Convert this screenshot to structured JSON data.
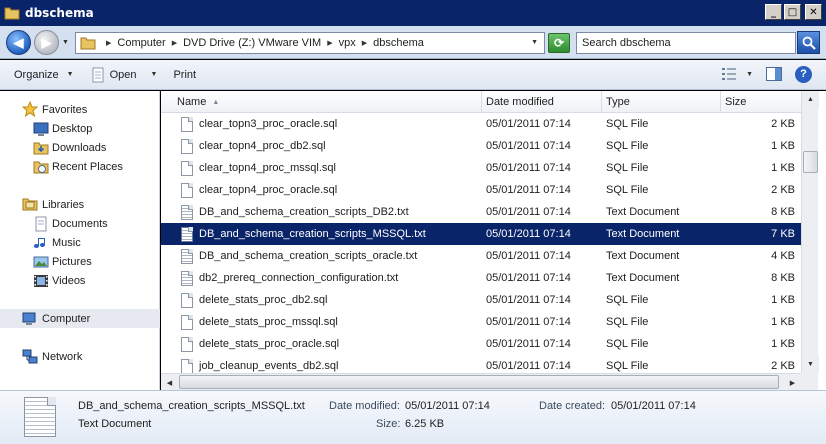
{
  "window": {
    "title": "dbschema"
  },
  "address": {
    "breadcrumbs": [
      "Computer",
      "DVD Drive (Z:) VMware VIM",
      "vpx",
      "dbschema"
    ],
    "search_placeholder": "Search dbschema"
  },
  "toolbar": {
    "organize": "Organize",
    "open": "Open",
    "print": "Print"
  },
  "nav": {
    "favorites": {
      "label": "Favorites",
      "items": [
        "Desktop",
        "Downloads",
        "Recent Places"
      ]
    },
    "libraries": {
      "label": "Libraries",
      "items": [
        "Documents",
        "Music",
        "Pictures",
        "Videos"
      ]
    },
    "computer": "Computer",
    "network": "Network"
  },
  "columns": {
    "name": "Name",
    "date": "Date modified",
    "type": "Type",
    "size": "Size"
  },
  "files": [
    {
      "name": "clear_topn3_proc_oracle.sql",
      "date": "05/01/2011 07:14",
      "type": "SQL File",
      "size": "2 KB",
      "kind": "sql"
    },
    {
      "name": "clear_topn4_proc_db2.sql",
      "date": "05/01/2011 07:14",
      "type": "SQL File",
      "size": "1 KB",
      "kind": "sql"
    },
    {
      "name": "clear_topn4_proc_mssql.sql",
      "date": "05/01/2011 07:14",
      "type": "SQL File",
      "size": "1 KB",
      "kind": "sql"
    },
    {
      "name": "clear_topn4_proc_oracle.sql",
      "date": "05/01/2011 07:14",
      "type": "SQL File",
      "size": "2 KB",
      "kind": "sql"
    },
    {
      "name": "DB_and_schema_creation_scripts_DB2.txt",
      "date": "05/01/2011 07:14",
      "type": "Text Document",
      "size": "8 KB",
      "kind": "txt"
    },
    {
      "name": "DB_and_schema_creation_scripts_MSSQL.txt",
      "date": "05/01/2011 07:14",
      "type": "Text Document",
      "size": "7 KB",
      "kind": "txt",
      "selected": true
    },
    {
      "name": "DB_and_schema_creation_scripts_oracle.txt",
      "date": "05/01/2011 07:14",
      "type": "Text Document",
      "size": "4 KB",
      "kind": "txt"
    },
    {
      "name": "db2_prereq_connection_configuration.txt",
      "date": "05/01/2011 07:14",
      "type": "Text Document",
      "size": "8 KB",
      "kind": "txt"
    },
    {
      "name": "delete_stats_proc_db2.sql",
      "date": "05/01/2011 07:14",
      "type": "SQL File",
      "size": "1 KB",
      "kind": "sql"
    },
    {
      "name": "delete_stats_proc_mssql.sql",
      "date": "05/01/2011 07:14",
      "type": "SQL File",
      "size": "1 KB",
      "kind": "sql"
    },
    {
      "name": "delete_stats_proc_oracle.sql",
      "date": "05/01/2011 07:14",
      "type": "SQL File",
      "size": "1 KB",
      "kind": "sql"
    },
    {
      "name": "job_cleanup_events_db2.sql",
      "date": "05/01/2011 07:14",
      "type": "SQL File",
      "size": "2 KB",
      "kind": "sql"
    }
  ],
  "details": {
    "filename": "DB_and_schema_creation_scripts_MSSQL.txt",
    "filetype": "Text Document",
    "date_modified_label": "Date modified:",
    "date_modified": "05/01/2011 07:14",
    "date_created_label": "Date created:",
    "date_created": "05/01/2011 07:14",
    "size_label": "Size:",
    "size": "6.25 KB"
  },
  "icons": {
    "back": "back-arrow-icon",
    "forward": "forward-arrow-icon",
    "refresh": "refresh-icon",
    "search": "magnifier-icon",
    "views": "views-icon",
    "preview_pane": "preview-pane-icon",
    "help": "help-icon"
  }
}
